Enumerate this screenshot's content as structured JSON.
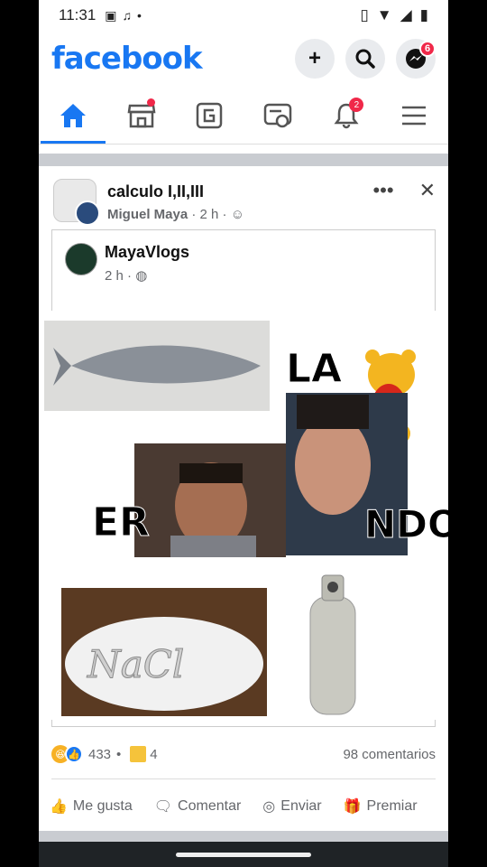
{
  "status": {
    "time": "11:31"
  },
  "header": {
    "logo": "facebook",
    "buttons": [
      {
        "icon": "plus-icon",
        "glyph": "+"
      },
      {
        "icon": "search-icon"
      },
      {
        "icon": "messenger-icon",
        "badge": "6"
      }
    ]
  },
  "tabs": [
    {
      "icon": "home-icon"
    },
    {
      "icon": "marketplace-icon",
      "dot": true
    },
    {
      "icon": "groups-icon"
    },
    {
      "icon": "watch-icon"
    },
    {
      "icon": "bell-icon",
      "badge": "2"
    },
    {
      "icon": "menu-icon"
    }
  ],
  "post": {
    "group": "calculo I,II,III",
    "author": "Miguel Maya",
    "time": "· 2 h ·",
    "shared": {
      "name": "MayaVlogs",
      "time": "2 h ·"
    },
    "meme": {
      "la": "LA",
      "er": "ER",
      "ndo": "NDO",
      "nacl": "NaCl"
    },
    "reactions": {
      "count": "433",
      "dot": "•",
      "gifts": "4",
      "comments": "98 comentarios"
    },
    "actions": {
      "like": "Me gusta",
      "comment": "Comentar",
      "send": "Enviar",
      "reward": "Premiar"
    }
  }
}
